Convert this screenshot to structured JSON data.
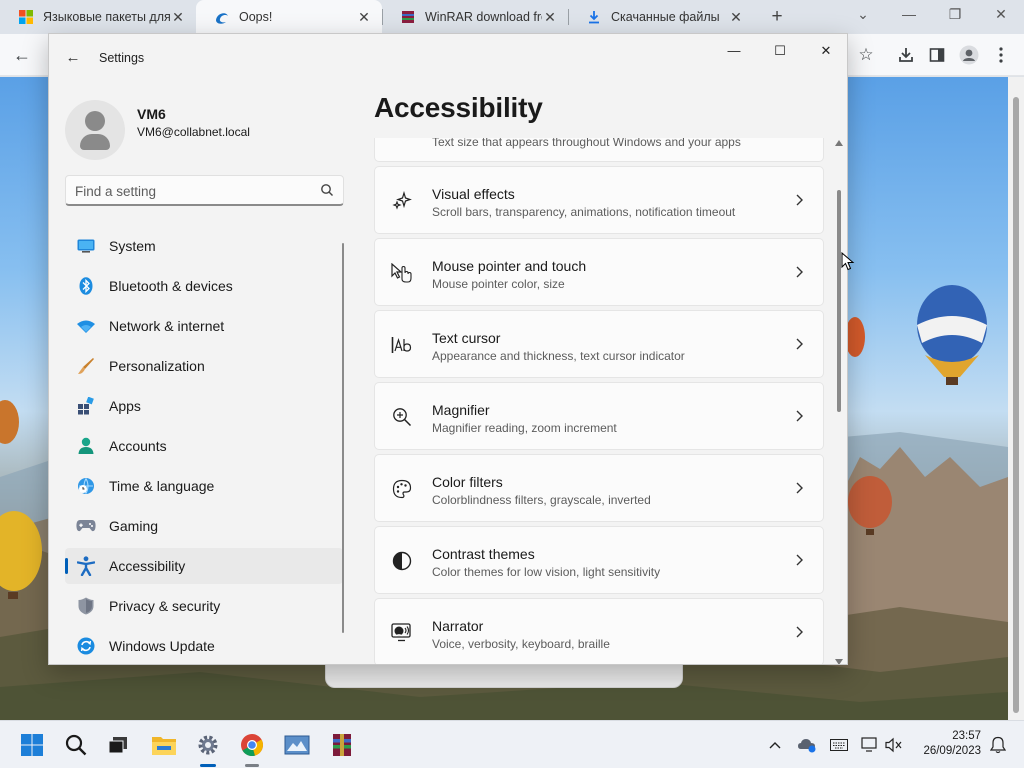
{
  "browser": {
    "tabs": [
      {
        "title": "Языковые пакеты для",
        "icon": "windows-logo-icon",
        "close": "✕"
      },
      {
        "title": "Oops!",
        "icon": "edge-swirl-icon",
        "close": "✕"
      },
      {
        "title": "WinRAR download free",
        "icon": "winrar-icon",
        "close": "✕"
      },
      {
        "title": "Скачанные файлы",
        "icon": "download-icon",
        "close": "✕"
      }
    ],
    "new_tab": "+",
    "controls": {
      "dropdown": "⌄",
      "minimize": "—",
      "restore": "❐",
      "close": "✕"
    },
    "toolbar": {
      "back": "←",
      "star": "☆"
    }
  },
  "settings": {
    "app_title": "Settings",
    "back": "←",
    "window_controls": {
      "minimize": "—",
      "maximize": "☐",
      "close": "✕"
    },
    "user": {
      "name": "VM6",
      "email": "VM6@collabnet.local"
    },
    "search": {
      "placeholder": "Find a setting"
    },
    "nav": [
      {
        "label": "System",
        "icon": "system-icon",
        "selected": false
      },
      {
        "label": "Bluetooth & devices",
        "icon": "bluetooth-icon",
        "selected": false
      },
      {
        "label": "Network & internet",
        "icon": "network-icon",
        "selected": false
      },
      {
        "label": "Personalization",
        "icon": "brush-icon",
        "selected": false
      },
      {
        "label": "Apps",
        "icon": "apps-icon",
        "selected": false
      },
      {
        "label": "Accounts",
        "icon": "accounts-icon",
        "selected": false
      },
      {
        "label": "Time & language",
        "icon": "globe-clock-icon",
        "selected": false
      },
      {
        "label": "Gaming",
        "icon": "gamepad-icon",
        "selected": false
      },
      {
        "label": "Accessibility",
        "icon": "accessibility-icon",
        "selected": true
      },
      {
        "label": "Privacy & security",
        "icon": "shield-icon",
        "selected": false
      },
      {
        "label": "Windows Update",
        "icon": "update-icon",
        "selected": false
      }
    ],
    "page_title": "Accessibility",
    "partial_card": {
      "subtitle": "Text size that appears throughout Windows and your apps"
    },
    "cards": [
      {
        "title": "Visual effects",
        "subtitle": "Scroll bars, transparency, animations, notification timeout",
        "icon": "sparkle-icon"
      },
      {
        "title": "Mouse pointer and touch",
        "subtitle": "Mouse pointer color, size",
        "icon": "pointer-touch-icon"
      },
      {
        "title": "Text cursor",
        "subtitle": "Appearance and thickness, text cursor indicator",
        "icon": "text-cursor-icon"
      },
      {
        "title": "Magnifier",
        "subtitle": "Magnifier reading, zoom increment",
        "icon": "magnifier-icon"
      },
      {
        "title": "Color filters",
        "subtitle": "Colorblindness filters, grayscale, inverted",
        "icon": "palette-icon"
      },
      {
        "title": "Contrast themes",
        "subtitle": "Color themes for low vision, light sensitivity",
        "icon": "contrast-icon"
      },
      {
        "title": "Narrator",
        "subtitle": "Voice, verbosity, keyboard, braille",
        "icon": "narrator-icon"
      }
    ],
    "accent_color": "#005fb8"
  },
  "taskbar": {
    "apps": [
      "start-icon",
      "search-icon",
      "task-view-icon",
      "file-explorer-icon",
      "settings-icon",
      "chrome-icon",
      "photos-icon",
      "winrar-icon"
    ],
    "tray": {
      "chevron": "^"
    },
    "clock": {
      "time": "23:57",
      "date": "26/09/2023"
    }
  }
}
